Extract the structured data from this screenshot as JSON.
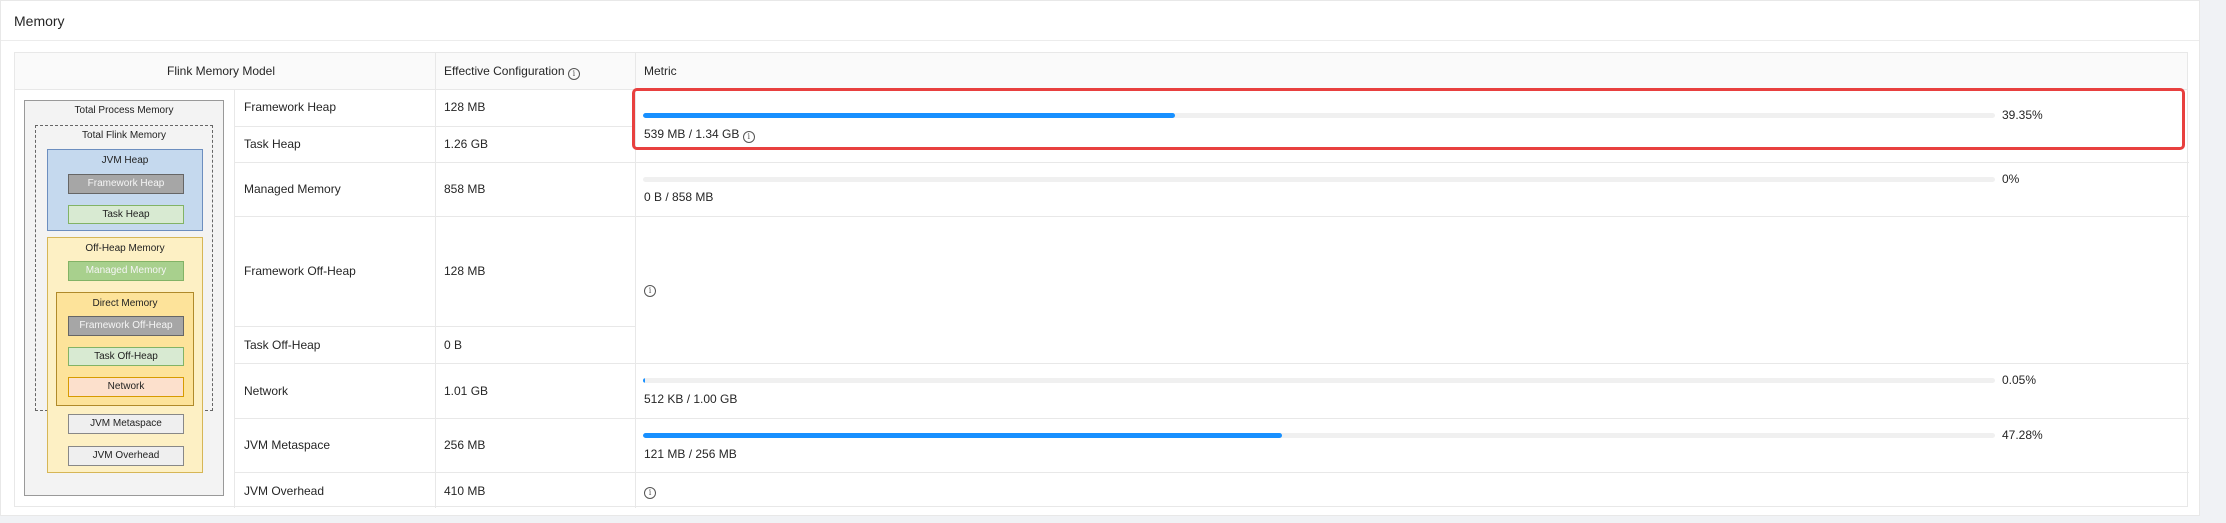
{
  "card": {
    "title": "Memory"
  },
  "table": {
    "headers": {
      "model": "Flink Memory Model",
      "config": "Effective Configuration",
      "metric": "Metric"
    },
    "rows": [
      {
        "name": "Framework Heap",
        "config": "128 MB"
      },
      {
        "name": "Task Heap",
        "config": "1.26 GB"
      },
      {
        "name": "Managed Memory",
        "config": "858 MB"
      },
      {
        "name": "Framework Off-Heap",
        "config": "128 MB"
      },
      {
        "name": "Task Off-Heap",
        "config": "0 B"
      },
      {
        "name": "Network",
        "config": "1.01 GB"
      },
      {
        "name": "JVM Metaspace",
        "config": "256 MB"
      },
      {
        "name": "JVM Overhead",
        "config": "410 MB"
      }
    ],
    "metrics": {
      "heap": {
        "percent": "39.35%",
        "value": 0.3935,
        "used": "539 MB / 1.34 GB"
      },
      "managed": {
        "percent": "0%",
        "value": 0,
        "used": "0 B / 858 MB"
      },
      "network": {
        "percent": "0.05%",
        "value": 0.0005,
        "used": "512 KB / 1.00 GB"
      },
      "metaspace": {
        "percent": "47.28%",
        "value": 0.4728,
        "used": "121 MB / 256 MB"
      }
    },
    "info_glyph": "i"
  },
  "diagram": {
    "total_process": "Total Process Memory",
    "total_flink": "Total Flink Memory",
    "jvm_heap": "JVM Heap",
    "framework_heap": "Framework Heap",
    "task_heap": "Task Heap",
    "off_heap": "Off-Heap Memory",
    "managed_memory": "Managed Memory",
    "direct_memory": "Direct Memory",
    "framework_off_heap": "Framework Off-Heap",
    "task_off_heap": "Task Off-Heap",
    "network": "Network",
    "jvm_metaspace": "JVM Metaspace",
    "jvm_overhead": "JVM Overhead"
  },
  "colors": {
    "accent": "#1890ff",
    "highlight": "#e8403f",
    "jvm_heap_bg": "#c5d9ee",
    "off_heap_bg": "#fdf0c4",
    "direct_bg": "#fde39a",
    "grey_box": "#a6a6a6",
    "green_box": "#d8ead2",
    "managed_box": "#a8d08d",
    "network_box": "#fce0cc"
  }
}
